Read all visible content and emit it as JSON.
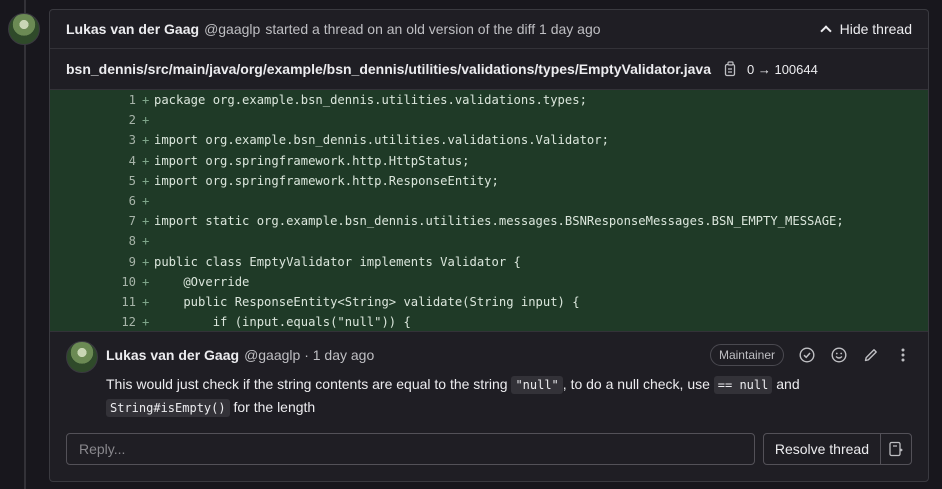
{
  "thread": {
    "author": "Lukas van der Gaag",
    "handle": "@gaaglp",
    "message": "started a thread on an old version of the diff 1 day ago",
    "hide_label": "Hide thread"
  },
  "file": {
    "path": "bsn_dennis/src/main/java/org/example/bsn_dennis/utilities/validations/types/EmptyValidator.java",
    "mode": "0 → 100644"
  },
  "code_lines": [
    {
      "n": "1",
      "text": "package org.example.bsn_dennis.utilities.validations.types;"
    },
    {
      "n": "2",
      "text": ""
    },
    {
      "n": "3",
      "text": "import org.example.bsn_dennis.utilities.validations.Validator;"
    },
    {
      "n": "4",
      "text": "import org.springframework.http.HttpStatus;"
    },
    {
      "n": "5",
      "text": "import org.springframework.http.ResponseEntity;"
    },
    {
      "n": "6",
      "text": ""
    },
    {
      "n": "7",
      "text": "import static org.example.bsn_dennis.utilities.messages.BSNResponseMessages.BSN_EMPTY_MESSAGE;"
    },
    {
      "n": "8",
      "text": ""
    },
    {
      "n": "9",
      "text": "public class EmptyValidator implements Validator {"
    },
    {
      "n": "10",
      "text": "    @Override"
    },
    {
      "n": "11",
      "text": "    public ResponseEntity<String> validate(String input) {"
    },
    {
      "n": "12",
      "text": "        if (input.equals(\"null\")) {"
    }
  ],
  "note": {
    "author": "Lukas van der Gaag",
    "meta": "@gaaglp · 1 day ago",
    "role_badge": "Maintainer",
    "body_1": "This would just check if the string contents are equal to the string ",
    "code_1": "\"null\"",
    "body_2": ", to do a null check, use ",
    "code_2": "== null",
    "body_3": " and",
    "code_3": "String#isEmpty()",
    "body_4": " for the length"
  },
  "reply": {
    "placeholder": "Reply...",
    "resolve_label": "Resolve thread"
  }
}
